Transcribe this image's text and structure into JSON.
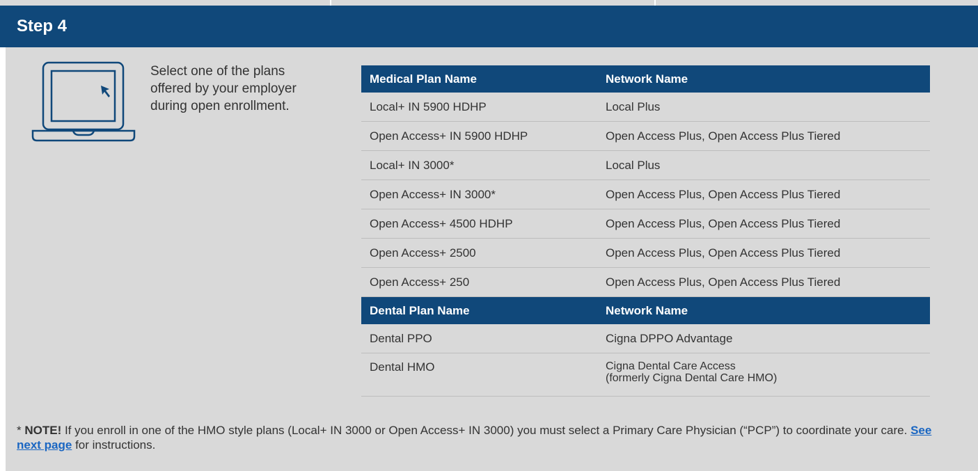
{
  "header": {
    "title": "Step 4"
  },
  "intro": {
    "text": "Select one of the plans offered by your employer during open enrollment."
  },
  "medical": {
    "headers": [
      "Medical Plan Name",
      "Network Name"
    ],
    "rows": [
      [
        "Local+ IN 5900 HDHP",
        "Local Plus"
      ],
      [
        "Open Access+ IN 5900 HDHP",
        "Open Access Plus, Open Access Plus Tiered"
      ],
      [
        "Local+ IN 3000*",
        "Local Plus"
      ],
      [
        "Open Access+ IN 3000*",
        "Open Access Plus, Open Access Plus Tiered"
      ],
      [
        "Open Access+ 4500 HDHP",
        "Open Access Plus, Open Access Plus Tiered"
      ],
      [
        "Open Access+ 2500",
        "Open Access Plus, Open Access Plus Tiered"
      ],
      [
        "Open Access+ 250",
        "Open Access Plus, Open Access Plus Tiered"
      ]
    ]
  },
  "dental": {
    "headers": [
      "Dental Plan Name",
      "Network Name"
    ],
    "rows": [
      [
        "Dental PPO",
        "Cigna DPPO Advantage",
        ""
      ],
      [
        "Dental HMO",
        "Cigna Dental Care Access",
        "(formerly Cigna Dental Care HMO)"
      ]
    ]
  },
  "note": {
    "prefix": "* ",
    "label": "NOTE!",
    "body": " If you enroll in one of the HMO style plans (Local+ IN 3000 or Open Access+ IN 3000) you must select a Primary Care Physician (“PCP”) to coordinate your care. ",
    "link": "See next page",
    "suffix": " for instructions."
  },
  "colors": {
    "header_blue": "#10487a",
    "panel_gray": "#d9d9d9",
    "link_blue": "#1a66c2"
  },
  "icons": {
    "laptop": "laptop-cursor-icon"
  }
}
